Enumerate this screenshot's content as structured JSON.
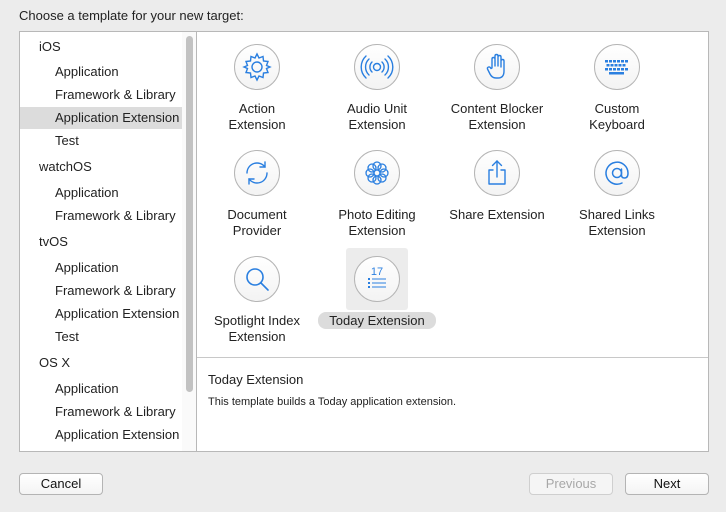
{
  "dialog": {
    "heading": "Choose a template for your new target:"
  },
  "sidebar": {
    "items": [
      {
        "label": "iOS",
        "kind": "platform"
      },
      {
        "label": "Application",
        "kind": "sub"
      },
      {
        "label": "Framework & Library",
        "kind": "sub"
      },
      {
        "label": "Application Extension",
        "kind": "sub",
        "selected": true
      },
      {
        "label": "Test",
        "kind": "sub"
      },
      {
        "label": "watchOS",
        "kind": "platform"
      },
      {
        "label": "Application",
        "kind": "sub"
      },
      {
        "label": "Framework & Library",
        "kind": "sub"
      },
      {
        "label": "tvOS",
        "kind": "platform"
      },
      {
        "label": "Application",
        "kind": "sub"
      },
      {
        "label": "Framework & Library",
        "kind": "sub"
      },
      {
        "label": "Application Extension",
        "kind": "sub"
      },
      {
        "label": "Test",
        "kind": "sub"
      },
      {
        "label": "OS X",
        "kind": "platform"
      },
      {
        "label": "Application",
        "kind": "sub"
      },
      {
        "label": "Framework & Library",
        "kind": "sub"
      },
      {
        "label": "Application Extension",
        "kind": "sub"
      }
    ]
  },
  "templates": [
    {
      "line1": "Action",
      "line2": "Extension",
      "icon": "gear-icon"
    },
    {
      "line1": "Audio Unit",
      "line2": "Extension",
      "icon": "audio-wave-icon"
    },
    {
      "line1": "Content Blocker",
      "line2": "Extension",
      "icon": "hand-icon"
    },
    {
      "line1": "Custom",
      "line2": "Keyboard",
      "icon": "keyboard-icon"
    },
    {
      "line1": "Document",
      "line2": "Provider",
      "icon": "sync-arrows-icon"
    },
    {
      "line1": "Photo Editing",
      "line2": "Extension",
      "icon": "flower-icon"
    },
    {
      "line1": "Share Extension",
      "line2": "",
      "icon": "share-icon"
    },
    {
      "line1": "Shared Links",
      "line2": "Extension",
      "icon": "at-sign-icon"
    },
    {
      "line1": "Spotlight Index",
      "line2": "Extension",
      "icon": "magnifier-icon"
    },
    {
      "line1": "Today Extension",
      "line2": "",
      "icon": "today-list-icon",
      "selected": true,
      "icon_number": "17"
    }
  ],
  "description": {
    "title": "Today Extension",
    "text": "This template builds a Today application extension."
  },
  "buttons": {
    "cancel": "Cancel",
    "previous": "Previous",
    "next": "Next"
  },
  "colors": {
    "accent_icon": "#2a7fe0",
    "selection": "#dcdcdc"
  }
}
